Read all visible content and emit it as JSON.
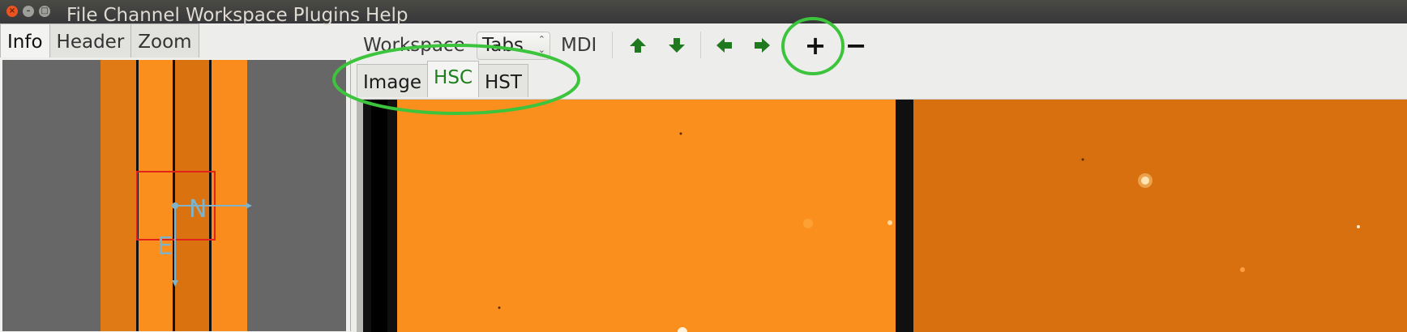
{
  "window": {
    "controls": {
      "close": "×",
      "minimize": "–",
      "maximize": "□"
    }
  },
  "menu": [
    "File",
    "Channel",
    "Workspace",
    "Plugins",
    "Help"
  ],
  "left_tabs": [
    {
      "label": "Info",
      "active": true
    },
    {
      "label": "Header",
      "active": false
    },
    {
      "label": "Zoom",
      "active": false
    }
  ],
  "pan": {
    "compass_north": "N",
    "compass_east": "E"
  },
  "toolbar": {
    "workspace_label": "Workspace",
    "workspace_type_value": "Tabs",
    "workspace_type_arrows": "⌃⌄",
    "mdi_label": "MDI",
    "buttons": [
      {
        "name": "up-arrow-icon"
      },
      {
        "name": "down-arrow-icon"
      },
      {
        "name": "left-arrow-icon"
      },
      {
        "name": "right-arrow-icon"
      }
    ],
    "add_label": "+",
    "remove_label": "−"
  },
  "channel_tabs": [
    {
      "label": "Image",
      "active": false
    },
    {
      "label": "HSC",
      "active": true
    },
    {
      "label": "HST",
      "active": false
    }
  ],
  "colors": {
    "accent_green": "#1d7f1d",
    "highlight_ring": "#3cc43c",
    "image_orange": "#fb8f1e",
    "image_dark_orange": "#d87010",
    "pan_cursor_red": "#e0241a",
    "compass": "#7fb3c9"
  }
}
